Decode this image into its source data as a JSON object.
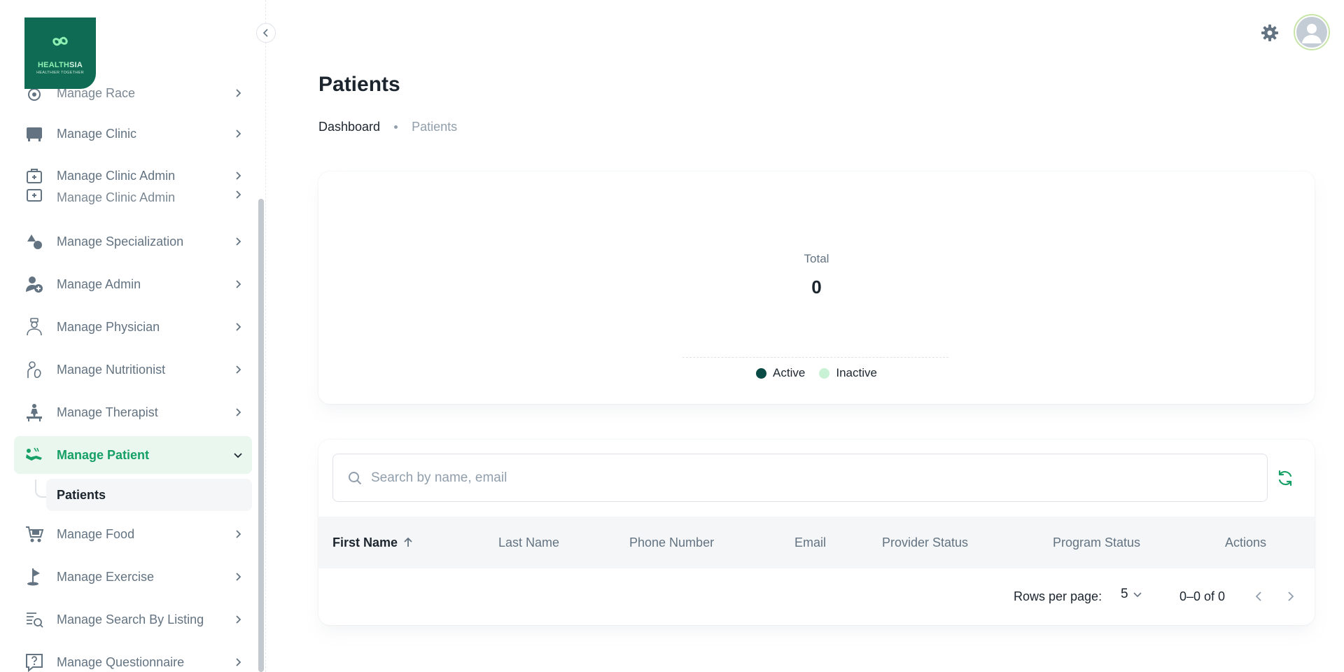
{
  "logo": {
    "brand_a": "HEALTH",
    "brand_b": "SIA",
    "tagline": "HEALTHIER TOGETHER"
  },
  "sidebar": {
    "items": [
      {
        "label": "Manage Race",
        "icon": "race-icon"
      },
      {
        "label": "Manage Clinic",
        "icon": "clinic-icon"
      },
      {
        "label": "Manage Clinic Admin",
        "icon": "clinic-admin-icon"
      },
      {
        "label": "Manage Clinic Admin",
        "icon": "clinic-admin-icon"
      },
      {
        "label": "Manage Specialization",
        "icon": "specialization-icon"
      },
      {
        "label": "Manage Admin",
        "icon": "admin-icon"
      },
      {
        "label": "Manage Physician",
        "icon": "physician-icon"
      },
      {
        "label": "Manage Nutritionist",
        "icon": "nutritionist-icon"
      },
      {
        "label": "Manage Therapist",
        "icon": "therapist-icon"
      },
      {
        "label": "Manage Patient",
        "icon": "patient-icon"
      },
      {
        "label": "Manage Food",
        "icon": "food-cart-icon"
      },
      {
        "label": "Manage Exercise",
        "icon": "exercise-icon"
      },
      {
        "label": "Manage Search By Listing",
        "icon": "search-listing-icon"
      },
      {
        "label": "Manage Questionnaire",
        "icon": "questionnaire-icon"
      }
    ],
    "sub_item": "Patients"
  },
  "header": {
    "title": "Patients"
  },
  "breadcrumb": {
    "link": "Dashboard",
    "current": "Patients"
  },
  "stats": {
    "total_label": "Total",
    "total_value": "0",
    "legend": [
      {
        "label": "Active",
        "color": "#0b4b45"
      },
      {
        "label": "Inactive",
        "color": "#c9f2d5"
      }
    ]
  },
  "table": {
    "search_placeholder": "Search by name, email",
    "columns": [
      "First Name",
      "Last Name",
      "Phone Number",
      "Email",
      "Provider Status",
      "Program Status",
      "Actions"
    ],
    "rows_per_page_label": "Rows per page:",
    "rows_per_page_value": "5",
    "range_text": "0–0 of 0"
  },
  "colors": {
    "brand": "#0f6b53",
    "accent": "#16a066",
    "active_bg": "#e9f7ef"
  }
}
